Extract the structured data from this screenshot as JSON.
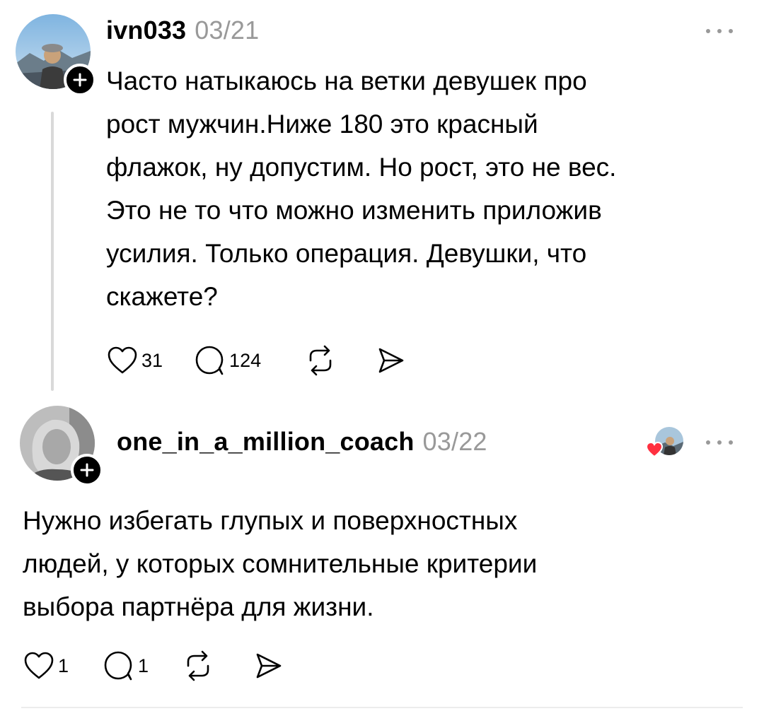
{
  "posts": [
    {
      "username": "ivn033",
      "date": "03/21",
      "text": "Часто натыкаюсь на ветки девушек про\nрост мужчин.Ниже 180 это красный\nфлажок, ну допустим. Но рост, это не вес.\nЭто не то что можно изменить приложив\nусилия. Только операция. Девушки, что\nскажете?",
      "likes": "31",
      "comments": "124"
    },
    {
      "username": "one_in_a_million_coach",
      "date": "03/22",
      "text": "Нужно избегать глупых и поверхностных\nлюдей, у которых сомнительные критерии\nвыбора партнёра для жизни.",
      "likes": "1",
      "comments": "1"
    }
  ],
  "icons": {
    "follow": "plus-icon",
    "more": "more-horizontal-icon",
    "like": "heart-outline-icon",
    "comment": "comment-bubble-icon",
    "repost": "repost-icon",
    "share": "send-icon",
    "liked_by_author": "heart-filled-icon"
  },
  "colors": {
    "text": "#000000",
    "muted": "#999999",
    "heart": "#ff3040",
    "divider": "#ececec"
  }
}
